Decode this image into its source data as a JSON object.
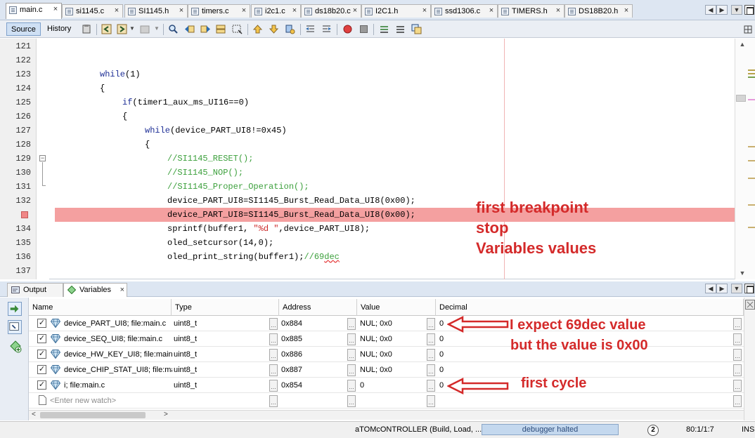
{
  "file_tabs": [
    "main.c",
    "si1145.c",
    "SI1145.h",
    "timers.c",
    "i2c1.c",
    "ds18b20.c",
    "I2C1.h",
    "ssd1306.c",
    "TIMERS.h",
    "DS18B20.h"
  ],
  "active_file_tab": 0,
  "toolbar": {
    "source_label": "Source",
    "history_label": "History"
  },
  "code_lines": [
    {
      "num": "121",
      "indent": 0,
      "parts": []
    },
    {
      "num": "122",
      "indent": 0,
      "parts": []
    },
    {
      "num": "123",
      "indent": 4,
      "parts": [
        {
          "t": "while",
          "c": "kw"
        },
        {
          "t": "(1)",
          "c": ""
        }
      ]
    },
    {
      "num": "124",
      "indent": 4,
      "parts": [
        {
          "t": "{",
          "c": ""
        }
      ]
    },
    {
      "num": "125",
      "indent": 8,
      "parts": [
        {
          "t": "if",
          "c": "kw"
        },
        {
          "t": "(timer1_aux_ms_UI16==0)",
          "c": ""
        }
      ]
    },
    {
      "num": "126",
      "indent": 8,
      "parts": [
        {
          "t": "{",
          "c": ""
        }
      ]
    },
    {
      "num": "127",
      "indent": 12,
      "parts": [
        {
          "t": "while",
          "c": "kw"
        },
        {
          "t": "(device_PART_UI8!=0x45)",
          "c": ""
        }
      ]
    },
    {
      "num": "128",
      "indent": 12,
      "parts": [
        {
          "t": "{",
          "c": ""
        }
      ]
    },
    {
      "num": "129",
      "indent": 16,
      "parts": [
        {
          "t": "//SI1145_RESET();",
          "c": "cm"
        }
      ]
    },
    {
      "num": "130",
      "indent": 16,
      "parts": [
        {
          "t": "//SI1145_NOP();",
          "c": "cm"
        }
      ]
    },
    {
      "num": "131",
      "indent": 16,
      "parts": [
        {
          "t": "//SI1145_Proper_Operation();",
          "c": "cm"
        }
      ]
    },
    {
      "num": "132",
      "indent": 16,
      "parts": [
        {
          "t": "device_PART_UI8=SI1145_Burst_Read_Data_UI8(0x00);",
          "c": ""
        }
      ]
    },
    {
      "num": "",
      "indent": 16,
      "breakpoint": true,
      "parts": [
        {
          "t": "device_PART_UI8=SI1145_Burst_Read_Data_UI8(0x00);",
          "c": ""
        }
      ]
    },
    {
      "num": "134",
      "indent": 16,
      "parts": [
        {
          "t": "sprintf(buffer1, ",
          "c": ""
        },
        {
          "t": "\"%d \"",
          "c": "str"
        },
        {
          "t": ",device_PART_UI8);",
          "c": ""
        }
      ]
    },
    {
      "num": "135",
      "indent": 16,
      "parts": [
        {
          "t": "oled_setcursor(14,0);",
          "c": ""
        }
      ]
    },
    {
      "num": "136",
      "indent": 16,
      "parts": [
        {
          "t": "oled_print_string(buffer1);",
          "c": ""
        },
        {
          "t": "//69",
          "c": "cm"
        },
        {
          "t": "dec",
          "c": "cm squig"
        }
      ]
    },
    {
      "num": "137",
      "indent": 0,
      "parts": []
    }
  ],
  "editor_annotation": {
    "line1": "first breakpoint",
    "line2": "stop",
    "line3": "Variables values"
  },
  "bottom_tabs": [
    "Output",
    "Variables"
  ],
  "active_bottom_tab": 1,
  "variables": {
    "columns": [
      "Name",
      "Type",
      "Address",
      "Value",
      "Decimal"
    ],
    "rows": [
      {
        "name": "device_PART_UI8; file:main.c",
        "type": "uint8_t",
        "address": "0x884",
        "value": "NUL; 0x0",
        "decimal": "0"
      },
      {
        "name": "device_SEQ_UI8; file:main.c",
        "type": "uint8_t",
        "address": "0x885",
        "value": "NUL; 0x0",
        "decimal": "0"
      },
      {
        "name": "device_HW_KEY_UI8; file:main.",
        "type": "uint8_t",
        "address": "0x886",
        "value": "NUL; 0x0",
        "decimal": "0"
      },
      {
        "name": "device_CHIP_STAT_UI8; file:ma",
        "type": "uint8_t",
        "address": "0x887",
        "value": "NUL; 0x0",
        "decimal": "0"
      },
      {
        "name": "i; file:main.c",
        "type": "uint8_t",
        "address": "0x854",
        "value": "0",
        "decimal": "0"
      }
    ],
    "new_watch_placeholder": "<Enter new watch>"
  },
  "var_annotations": {
    "expect_line1": "I expect  69dec value",
    "expect_line2": "but the value is 0x00",
    "cycle": "first cycle"
  },
  "statusbar": {
    "project": "aTOMcONTROLLER (Build, Load, ...)",
    "debugger_status": "debugger halted",
    "help_badge": "2",
    "position": "80:1/1:7",
    "mode": "INS"
  },
  "colors": {
    "breakpoint_line": "#f4a0a0",
    "annotation": "#d42a2a",
    "keyword": "#1e2f96",
    "comment": "#3ca03c",
    "string": "#cc2a2a"
  }
}
